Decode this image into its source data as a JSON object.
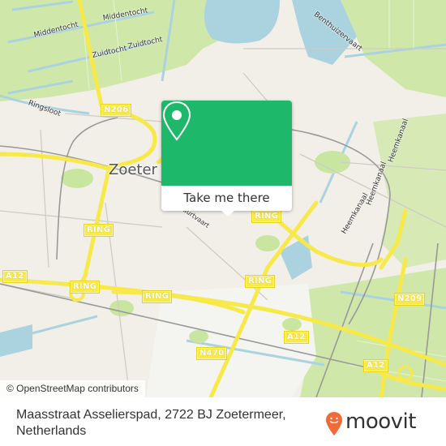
{
  "map": {
    "city_label": "Zoeter",
    "water_labels": [
      "Middentocht",
      "Middentocht",
      "Zuidtocht",
      "Zuidtocht",
      "Ringsloot",
      "Benthuizervaart",
      "Heemkanaal",
      "Heemkanaal",
      "Heemkanaal",
      "Heemkanaal",
      "Buurtvaart"
    ],
    "road_shields": [
      "N206",
      "RING",
      "RING",
      "A12",
      "RING",
      "RING",
      "RING",
      "N470",
      "A12",
      "A12",
      "A12",
      "N209"
    ],
    "attribution": "© OpenStreetMap contributors",
    "colors": {
      "land": "#f2efe9",
      "farmland": "#cfe8a9",
      "water": "#aad3df",
      "highway": "#f7e94a",
      "park": "#c8e6a0"
    }
  },
  "popup": {
    "icon": "map-pin-icon",
    "button_label": "Take me there",
    "color": "#1db86a"
  },
  "footer": {
    "address_line1": "Maasstraat Asselierspad, 2722 BJ Zoetermeer,",
    "address_line2": "Netherlands",
    "brand": "moovit",
    "brand_color": "#f26a3a"
  }
}
